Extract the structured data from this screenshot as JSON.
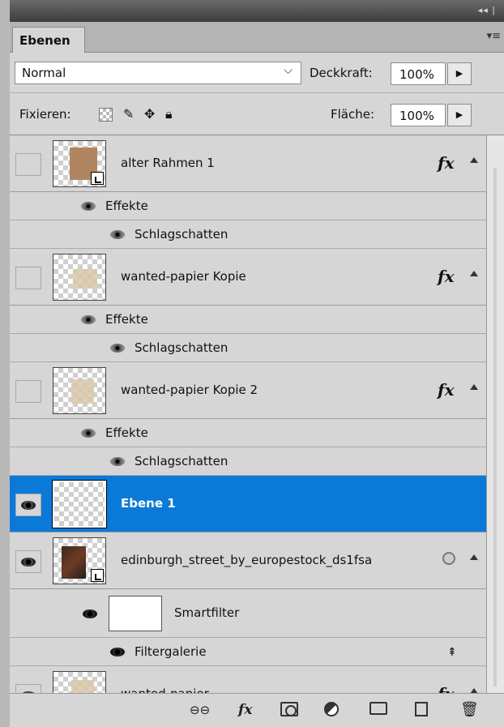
{
  "panel": {
    "tab_label": "Ebenen",
    "collapse_glyph": "◂◂ |",
    "menu_glyph": "▾≡"
  },
  "blend": {
    "mode": "Normal",
    "opacity_label": "Deckkraft:",
    "opacity_value": "100%"
  },
  "lock": {
    "label": "Fixieren:",
    "fill_label": "Fläche:",
    "fill_value": "100%"
  },
  "layers": [
    {
      "name": "alter Rahmen 1",
      "visible": false,
      "effects_label": "Effekte",
      "effect": "Schlagschatten"
    },
    {
      "name": "wanted-papier Kopie",
      "visible": false,
      "effects_label": "Effekte",
      "effect": "Schlagschatten"
    },
    {
      "name": "wanted-papier Kopie 2",
      "visible": false,
      "effects_label": "Effekte",
      "effect": "Schlagschatten"
    },
    {
      "name": "Ebene 1",
      "visible": true,
      "selected": true
    },
    {
      "name": "edinburgh_street_by_europestock_ds1fsa",
      "visible": true,
      "smartfilter_label": "Smartfilter",
      "filter": "Filtergalerie"
    },
    {
      "name": "wanted-papier",
      "visible": true
    }
  ],
  "icons": {
    "fx": "fx",
    "link": "⊖⊖",
    "trash": "🗑"
  },
  "colors": {
    "selected": "#0b79d8",
    "panel_bg": "#d6d6d6"
  }
}
